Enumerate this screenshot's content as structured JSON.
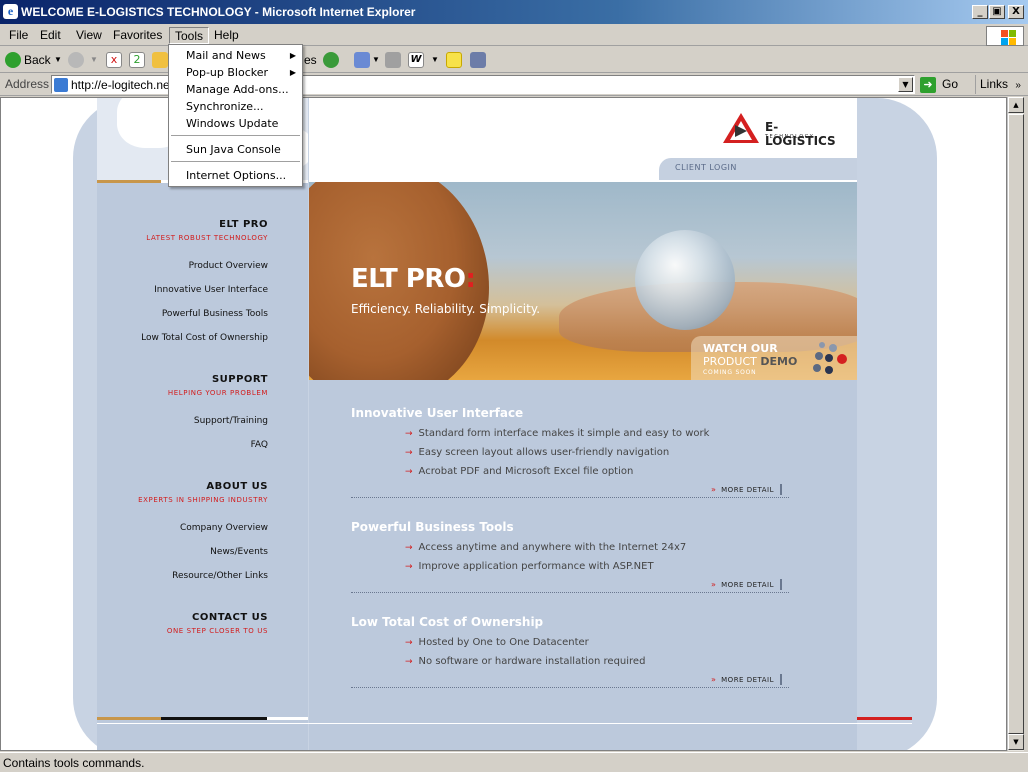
{
  "window": {
    "title": "WELCOME E-LOGISTICS TECHNOLOGY - Microsoft Internet Explorer",
    "minimize": "_",
    "maximize": "▣",
    "close": "X"
  },
  "menubar": {
    "file": "File",
    "edit": "Edit",
    "view": "View",
    "favorites": "Favorites",
    "tools": "Tools",
    "help": "Help"
  },
  "toolbar": {
    "back": "Back",
    "favorites_fragment": "es"
  },
  "address": {
    "label": "Address",
    "url": "http://e-logitech.ne",
    "go": "Go",
    "links": "Links"
  },
  "tools_menu": {
    "items": [
      {
        "label": "Mail and News",
        "submenu": true
      },
      {
        "label": "Pop-up Blocker",
        "submenu": true
      },
      {
        "label": "Manage Add-ons...",
        "submenu": false
      },
      {
        "label": "Synchronize...",
        "submenu": false
      },
      {
        "label": "Windows Update",
        "submenu": false
      },
      {
        "label": "Sun Java Console",
        "submenu": false
      },
      {
        "label": "Internet Options...",
        "submenu": false
      }
    ],
    "submenu_arrow": "▶"
  },
  "status": {
    "text": "Contains tools commands."
  },
  "site": {
    "logo": {
      "name": "E-LOGISTICS",
      "sub": "TECHNOLOGY"
    },
    "client_login": "CLIENT LOGIN",
    "hero": {
      "title": "ELT PRO",
      "colon": ":",
      "tagline": "Efficiency. Reliability. Simplicity.",
      "demo_line1": "WATCH OUR",
      "demo_line2_a": "PRODUCT",
      "demo_line2_b": "DEMO",
      "demo_line3": "COMING SOON"
    },
    "nav": {
      "eltpro": {
        "head": "ELT PRO",
        "sub": "LATEST ROBUST TECHNOLOGY",
        "links": [
          "Product Overview",
          "Innovative User Interface",
          "Powerful Business Tools",
          "Low Total Cost of Ownership"
        ]
      },
      "support": {
        "head": "SUPPORT",
        "sub": "HELPING YOUR PROBLEM",
        "links": [
          "Support/Training",
          "FAQ"
        ]
      },
      "about": {
        "head": "ABOUT US",
        "sub": "EXPERTS IN SHIPPING INDUSTRY",
        "links": [
          "Company Overview",
          "News/Events",
          "Resource/Other Links"
        ]
      },
      "contact": {
        "head": "CONTACT US",
        "sub": "ONE STEP CLOSER TO US"
      }
    },
    "sections": [
      {
        "title": "Innovative User Interface",
        "bullets": [
          "Standard form interface makes it simple and easy to work",
          "Easy screen layout allows user-friendly navigation",
          "Acrobat PDF and Microsoft Excel file option"
        ],
        "more": "MORE DETAIL"
      },
      {
        "title": "Powerful Business Tools",
        "bullets": [
          "Access anytime and anywhere with the Internet 24x7",
          "Improve application performance with ASP.NET"
        ],
        "more": "MORE DETAIL"
      },
      {
        "title": "Low Total Cost of Ownership",
        "bullets": [
          "Hosted by One to One Datacenter",
          "No software or hardware installation required"
        ],
        "more": "MORE DETAIL"
      }
    ],
    "arrow_glyph": "»",
    "bullet_glyph": "→"
  }
}
